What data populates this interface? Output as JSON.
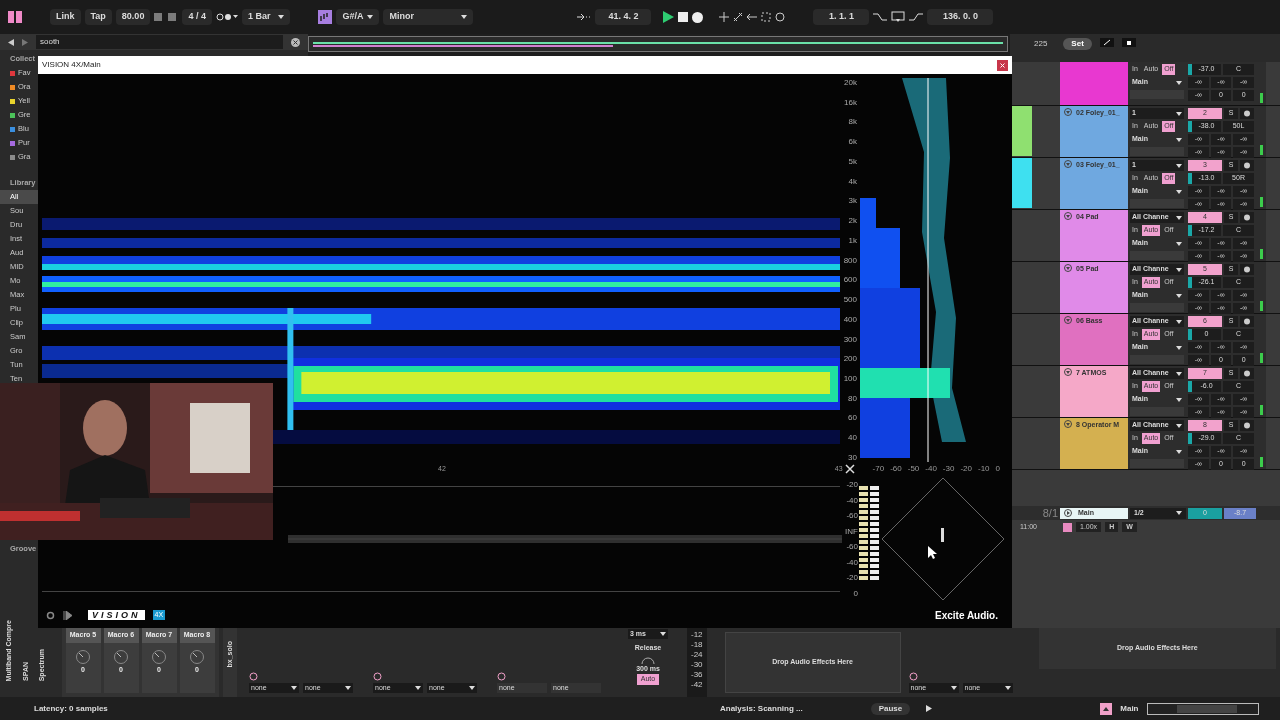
{
  "top_bar": {
    "link": "Link",
    "tap": "Tap",
    "tempo": "80.00",
    "signature": "4 / 4",
    "quantize": "1 Bar",
    "key": "G#/A",
    "scale": "Minor",
    "position": "41.  4.  2",
    "loop_start": "1.  1.  1",
    "loop_length": "136.  0.  0"
  },
  "browser": {
    "search": "sooth",
    "collections_heading": "Collect",
    "collections": [
      {
        "label": "Fav",
        "color": "#e0383e"
      },
      {
        "label": "Ora",
        "color": "#f08a24"
      },
      {
        "label": "Yell",
        "color": "#e8d32c"
      },
      {
        "label": "Gre",
        "color": "#4cc35a"
      },
      {
        "label": "Blu",
        "color": "#3a8fe0"
      },
      {
        "label": "Pur",
        "color": "#a66be0"
      },
      {
        "label": "Gra",
        "color": "#8c8c8c"
      }
    ],
    "library_heading": "Library",
    "library": [
      {
        "label": "All",
        "selected": true
      },
      {
        "label": "Sou",
        "selected": false
      },
      {
        "label": "Dru",
        "selected": false
      },
      {
        "label": "Inst",
        "selected": false
      },
      {
        "label": "Aud",
        "selected": false
      },
      {
        "label": "MID",
        "selected": false
      },
      {
        "label": "Mo",
        "selected": false
      },
      {
        "label": "Max",
        "selected": false
      },
      {
        "label": "Plu",
        "selected": false
      },
      {
        "label": "Clip",
        "selected": false
      },
      {
        "label": "Sam",
        "selected": false
      },
      {
        "label": "Gro",
        "selected": false
      },
      {
        "label": "Tun",
        "selected": false
      },
      {
        "label": "Ten",
        "selected": false
      }
    ],
    "groove": "Groove"
  },
  "plugin_window": {
    "title": "VISION 4X/Main",
    "freq_labels": [
      "20k",
      "16k",
      "8k",
      "6k",
      "5k",
      "4k",
      "3k",
      "2k",
      "1k",
      "800",
      "600",
      "500",
      "400",
      "300",
      "200",
      "100",
      "80",
      "60",
      "40",
      "30"
    ],
    "db_axis": [
      "-70",
      "-60",
      "-50",
      "-40",
      "-30",
      "-20",
      "-10",
      "0"
    ],
    "time_labels": [
      "42",
      "43"
    ],
    "meter_labels": [
      "-20",
      "-40",
      "-60",
      "INF",
      "-60",
      "-40",
      "-20",
      "0"
    ],
    "logo": "VISION",
    "badge": "4X",
    "brand": "Excite Audio."
  },
  "session": {
    "tempo_marker": "225",
    "set": "Set",
    "tracks": [
      {
        "color": "#e838d0",
        "monitor": [
          {
            "label": "In",
            "selected": false
          },
          {
            "label": "Auto",
            "selected": false
          },
          {
            "label": "Off",
            "selected": true
          }
        ],
        "volume": "-37.0",
        "pan": "C",
        "output": "Main",
        "sends": [
          "-∞",
          "-∞",
          "-∞"
        ],
        "returns": [
          "-∞",
          "0",
          "0"
        ]
      },
      {
        "name": "02 Foley_01_",
        "color": "#6fa8e0",
        "clip": {
          "color": "#8fe070"
        },
        "input": "1",
        "number": "2",
        "solo": "S",
        "monitor": [
          {
            "label": "In",
            "selected": false
          },
          {
            "label": "Auto",
            "selected": false
          },
          {
            "label": "Off",
            "selected": true
          }
        ],
        "volume": "-38.0",
        "pan": "50L",
        "output": "Main",
        "sends": [
          "-∞",
          "-∞",
          "-∞"
        ],
        "returns": [
          "-∞",
          "-∞",
          "-∞"
        ]
      },
      {
        "name": "03 Foley_01_",
        "color": "#6fa8e0",
        "clip": {
          "color": "#3ee0f0"
        },
        "input": "1",
        "number": "3",
        "solo": "S",
        "monitor": [
          {
            "label": "In",
            "selected": false
          },
          {
            "label": "Auto",
            "selected": false
          },
          {
            "label": "Off",
            "selected": true
          }
        ],
        "volume": "-13.0",
        "pan": "50R",
        "output": "Main",
        "sends": [
          "-∞",
          "-∞",
          "-∞"
        ],
        "returns": [
          "-∞",
          "-∞",
          "-∞"
        ]
      },
      {
        "name": "04 Pad",
        "color": "#e08ae8",
        "input": "All Channe",
        "number": "4",
        "solo": "S",
        "monitor": [
          {
            "label": "In",
            "selected": false
          },
          {
            "label": "Auto",
            "selected": true
          },
          {
            "label": "Off",
            "selected": false
          }
        ],
        "volume": "-17.2",
        "pan": "C",
        "output": "Main",
        "sends": [
          "-∞",
          "-∞",
          "-∞"
        ],
        "returns": [
          "-∞",
          "-∞",
          "-∞"
        ]
      },
      {
        "name": "05 Pad",
        "color": "#e08ae8",
        "input": "All Channe",
        "number": "5",
        "solo": "S",
        "monitor": [
          {
            "label": "In",
            "selected": false
          },
          {
            "label": "Auto",
            "selected": true
          },
          {
            "label": "Off",
            "selected": false
          }
        ],
        "volume": "-26.1",
        "pan": "C",
        "output": "Main",
        "sends": [
          "-∞",
          "-∞",
          "-∞"
        ],
        "returns": [
          "-∞",
          "-∞",
          "-∞"
        ]
      },
      {
        "name": "06 Bass",
        "color": "#e070c0",
        "input": "All Channe",
        "number": "6",
        "solo": "S",
        "monitor": [
          {
            "label": "In",
            "selected": false
          },
          {
            "label": "Auto",
            "selected": true
          },
          {
            "label": "Off",
            "selected": false
          }
        ],
        "volume": "0",
        "pan": "C",
        "output": "Main",
        "sends": [
          "-∞",
          "-∞",
          "-∞"
        ],
        "returns": [
          "-∞",
          "0",
          "0"
        ]
      },
      {
        "name": "7 ATMOS",
        "color": "#f5a8c8",
        "input": "All Channe",
        "number": "7",
        "solo": "S",
        "monitor": [
          {
            "label": "In",
            "selected": false
          },
          {
            "label": "Auto",
            "selected": true
          },
          {
            "label": "Off",
            "selected": false
          }
        ],
        "volume": "-6.0",
        "pan": "C",
        "output": "Main",
        "sends": [
          "-∞",
          "-∞",
          "-∞"
        ],
        "returns": [
          "-∞",
          "-∞",
          "-∞"
        ]
      },
      {
        "name": "8 Operator M",
        "color": "#d4b050",
        "input": "All Channe",
        "number": "8",
        "solo": "S",
        "monitor": [
          {
            "label": "In",
            "selected": false
          },
          {
            "label": "Auto",
            "selected": true
          },
          {
            "label": "Off",
            "selected": false
          }
        ],
        "volume": "-29.0",
        "pan": "C",
        "output": "Main",
        "sends": [
          "-∞",
          "-∞",
          "-∞"
        ],
        "returns": [
          "-∞",
          "0",
          "0"
        ]
      }
    ],
    "main": {
      "scene": "8/1",
      "name": "Main",
      "channels": "1/2",
      "volume": "0",
      "pan": "-8.7",
      "time": "11:00",
      "speed": "1.00x",
      "h": "H",
      "w": "W"
    }
  },
  "devices": {
    "titles": [
      "Multiband Compre",
      "SPAN",
      "Spectrum"
    ],
    "macros": [
      {
        "label": "Macro 5",
        "value": "0"
      },
      {
        "label": "Macro 6",
        "value": "0"
      },
      {
        "label": "Macro 7",
        "value": "0"
      },
      {
        "label": "Macro 8",
        "value": "0"
      }
    ],
    "solo_title": "bx_solo",
    "pads": [
      {
        "kind": "dropdown",
        "fields": [
          "none",
          "none"
        ]
      },
      {
        "kind": "dropdown",
        "fields": [
          "none",
          "none"
        ]
      },
      {
        "kind": "plain",
        "fields": [
          "none",
          "none"
        ]
      }
    ],
    "compressor": {
      "attack": "3 ms",
      "release_label": "Release",
      "release": "300 ms",
      "auto": "Auto",
      "scale": [
        "-12",
        "-18",
        "-24",
        "-30",
        "-36",
        "-42"
      ]
    },
    "drop_left": "Drop Audio Effects Here",
    "last_pad": [
      "none",
      "none"
    ],
    "drop_right": "Drop Audio Effects Here"
  },
  "status_bar": {
    "latency": "Latency: 0 samples",
    "analysis": "Analysis: Scanning ...",
    "pause": "Pause",
    "main": "Main"
  }
}
